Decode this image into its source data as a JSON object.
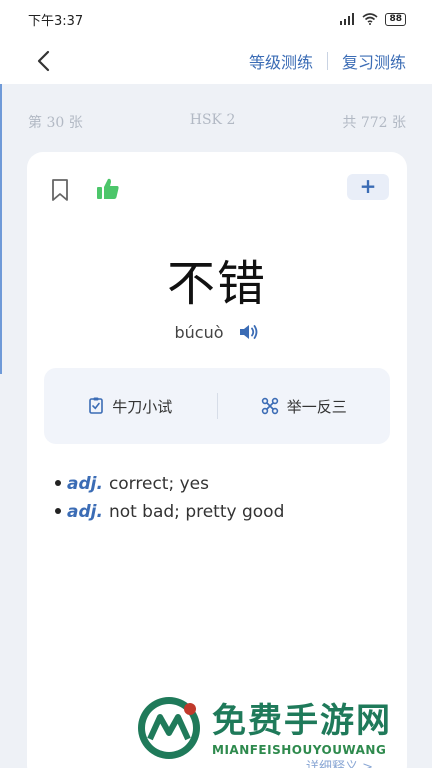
{
  "status_bar": {
    "time": "下午3:37",
    "battery": "88"
  },
  "nav": {
    "level_test_label": "等级测练",
    "review_label": "复习测练"
  },
  "counter": {
    "current": "第 30 张",
    "level": "HSK 2",
    "total": "共 772 张"
  },
  "card": {
    "word": "不错",
    "pinyin": "búcuò",
    "add_label": "+",
    "practice": {
      "quiz_label": "牛刀小试",
      "extend_label": "举一反三"
    },
    "definitions": [
      {
        "pos": "adj.",
        "meaning": "correct; yes"
      },
      {
        "pos": "adj.",
        "meaning": "not bad; pretty good"
      }
    ]
  },
  "watermark": {
    "title": "免费手游网",
    "subtitle": "MIANFEISHOUYOUWANG"
  },
  "more_link": "详细释义 >",
  "colors": {
    "accent": "#3b6cb5",
    "like_green": "#4cc66a",
    "background": "#eef1f6"
  }
}
